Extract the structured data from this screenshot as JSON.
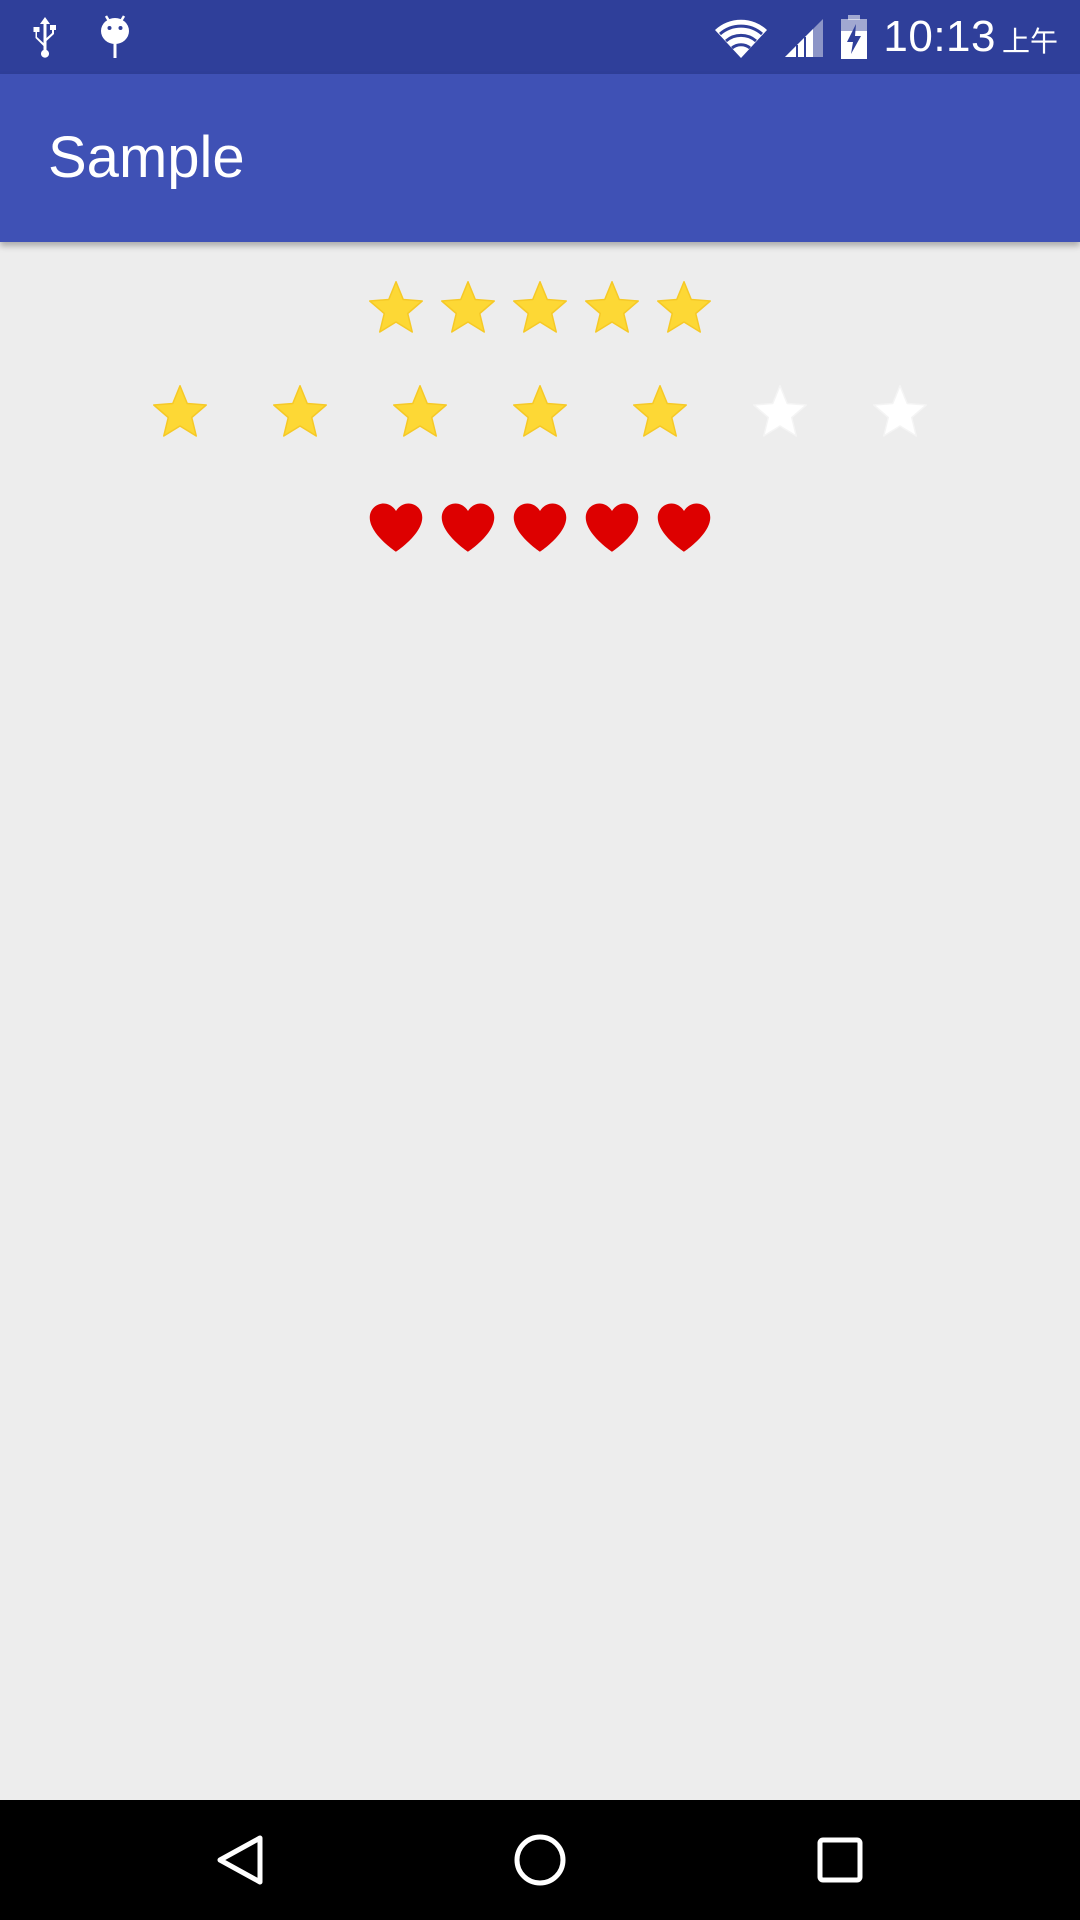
{
  "status_bar": {
    "time": "10:13",
    "ampm": "上午",
    "icons": [
      "usb-icon",
      "android-debug-icon",
      "wifi-icon",
      "signal-icon",
      "battery-charging-icon"
    ]
  },
  "app_bar": {
    "title": "Sample",
    "color": "#3f51b5"
  },
  "ratings": [
    {
      "name": "star-rating-small",
      "icon": "star-icon",
      "value": 5,
      "max": 5,
      "filled_color": "#fdd835",
      "empty_color": "#ffffff"
    },
    {
      "name": "star-rating-large",
      "icon": "star-icon",
      "value": 5,
      "max": 7,
      "filled_color": "#fdd835",
      "empty_color": "#ffffff"
    },
    {
      "name": "heart-rating",
      "icon": "heart-icon",
      "value": 5,
      "max": 5,
      "filled_color": "#dd0000",
      "empty_color": "#ffffff"
    }
  ],
  "nav_bar": {
    "buttons": [
      "back-icon",
      "home-icon",
      "recents-icon"
    ]
  }
}
